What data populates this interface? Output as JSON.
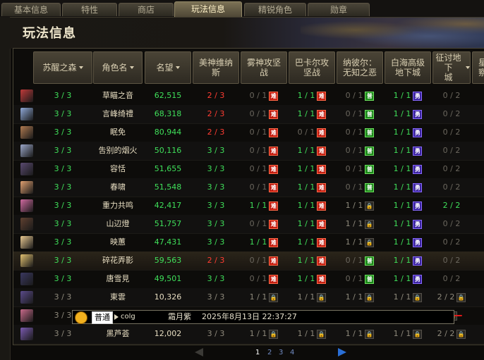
{
  "tabs": [
    {
      "label": "基本信息",
      "active": false
    },
    {
      "label": "特性",
      "active": false
    },
    {
      "label": "商店",
      "active": false
    },
    {
      "label": "玩法信息",
      "active": true
    },
    {
      "label": "精锐角色",
      "active": false
    },
    {
      "label": "勋章",
      "active": false
    }
  ],
  "page_title": "玩法信息",
  "columns": [
    {
      "label": "苏醒之森",
      "sort": true
    },
    {
      "label": "角色名",
      "sort": true
    },
    {
      "label": "名望",
      "sort": true
    },
    {
      "label": "美神维纳\n斯",
      "sort": false
    },
    {
      "label": "雾神攻坚\n战",
      "sort": false
    },
    {
      "label": "巴卡尔攻\n坚战",
      "sort": false
    },
    {
      "label": "纳彼尔：\n无知之恶",
      "sort": false
    },
    {
      "label": "白海高级\n地下城",
      "sort": false
    },
    {
      "label": "征讨地下\n城",
      "sort": true
    },
    {
      "label": "星\n察",
      "sort": false
    }
  ],
  "badges": {
    "nan": "难",
    "pu": "普",
    "yong": "勇",
    "lock": "🔒"
  },
  "rows": [
    {
      "forest": "3 / 3",
      "name": "草瞄之音",
      "fame": "62,515",
      "venus": "2 / 3",
      "fog": "0 / 1",
      "bakal": "1 / 1",
      "nabir": "0 / 1",
      "white": "1 / 1",
      "raid": "0 / 2"
    },
    {
      "forest": "3 / 3",
      "name": "言峰绮禮",
      "fame": "68,318",
      "venus": "2 / 3",
      "fog": "0 / 1",
      "bakal": "1 / 1",
      "nabir": "0 / 1",
      "white": "1 / 1",
      "raid": "0 / 2"
    },
    {
      "forest": "3 / 3",
      "name": "眠免",
      "fame": "80,944",
      "venus": "2 / 3",
      "fog": "0 / 1",
      "bakal": "0 / 1",
      "nabir": "0 / 1",
      "white": "1 / 1",
      "raid": "0 / 2"
    },
    {
      "forest": "3 / 3",
      "name": "吿别的烟火",
      "fame": "50,116",
      "venus": "3 / 3",
      "fog": "0 / 1",
      "bakal": "1 / 1",
      "nabir": "0 / 1",
      "white": "1 / 1",
      "raid": "0 / 2"
    },
    {
      "forest": "3 / 3",
      "name": "容恬",
      "fame": "51,655",
      "venus": "3 / 3",
      "fog": "0 / 1",
      "bakal": "1 / 1",
      "nabir": "0 / 1",
      "white": "1 / 1",
      "raid": "0 / 2"
    },
    {
      "forest": "3 / 3",
      "name": "春啸",
      "fame": "51,548",
      "venus": "3 / 3",
      "fog": "0 / 1",
      "bakal": "1 / 1",
      "nabir": "0 / 1",
      "white": "1 / 1",
      "raid": "0 / 2"
    },
    {
      "forest": "3 / 3",
      "name": "重力共鸣",
      "fame": "42,417",
      "venus": "3 / 3",
      "fog": "1 / 1",
      "bakal": "1 / 1",
      "nabir": "1 / 1",
      "white": "1 / 1",
      "raid": "2 / 2"
    },
    {
      "forest": "3 / 3",
      "name": "山辺燈",
      "fame": "51,757",
      "venus": "3 / 3",
      "fog": "0 / 1",
      "bakal": "1 / 1",
      "nabir": "1 / 1",
      "white": "1 / 1",
      "raid": "0 / 2"
    },
    {
      "forest": "3 / 3",
      "name": "映蕙",
      "fame": "47,431",
      "venus": "3 / 3",
      "fog": "1 / 1",
      "bakal": "1 / 1",
      "nabir": "1 / 1",
      "white": "1 / 1",
      "raid": "0 / 2"
    },
    {
      "forest": "3 / 3",
      "name": "碎花弄影",
      "fame": "59,563",
      "venus": "2 / 3",
      "fog": "0 / 1",
      "bakal": "1 / 1",
      "nabir": "0 / 1",
      "white": "1 / 1",
      "raid": "0 / 2"
    },
    {
      "forest": "3 / 3",
      "name": "唐雪見",
      "fame": "49,501",
      "venus": "3 / 3",
      "fog": "0 / 1",
      "bakal": "1 / 1",
      "nabir": "0 / 1",
      "white": "1 / 1",
      "raid": "0 / 2"
    },
    {
      "forest": "3 / 3",
      "name": "東雲",
      "fame": "10,326",
      "venus": "3 / 3",
      "fog": "1 / 1",
      "bakal": "1 / 1",
      "nabir": "1 / 1",
      "white": "1 / 1",
      "raid": "2 / 2"
    },
    {
      "forest": "3 / 3",
      "name": "",
      "fame": "",
      "venus": "",
      "fog": "",
      "bakal": "",
      "nabir": "",
      "white": "",
      "raid": ""
    },
    {
      "forest": "3 / 3",
      "name": "黑芦荟",
      "fame": "12,002",
      "venus": "3 / 3",
      "fog": "1 / 1",
      "bakal": "1 / 1",
      "nabir": "1 / 1",
      "white": "1 / 1",
      "raid": "2 / 2"
    }
  ],
  "popup": {
    "channel": "普通",
    "source": "colg",
    "sender": "霜月紫",
    "time": "2025年8月13日 22:37:27"
  },
  "pagination": {
    "pages": [
      "1",
      "2",
      "3",
      "4"
    ],
    "current": "1"
  },
  "colors": {
    "green": "#3fe05a",
    "red": "#ff3c32",
    "gold_text": "#d9cfb2",
    "accent_blue": "#2a6fd6"
  }
}
